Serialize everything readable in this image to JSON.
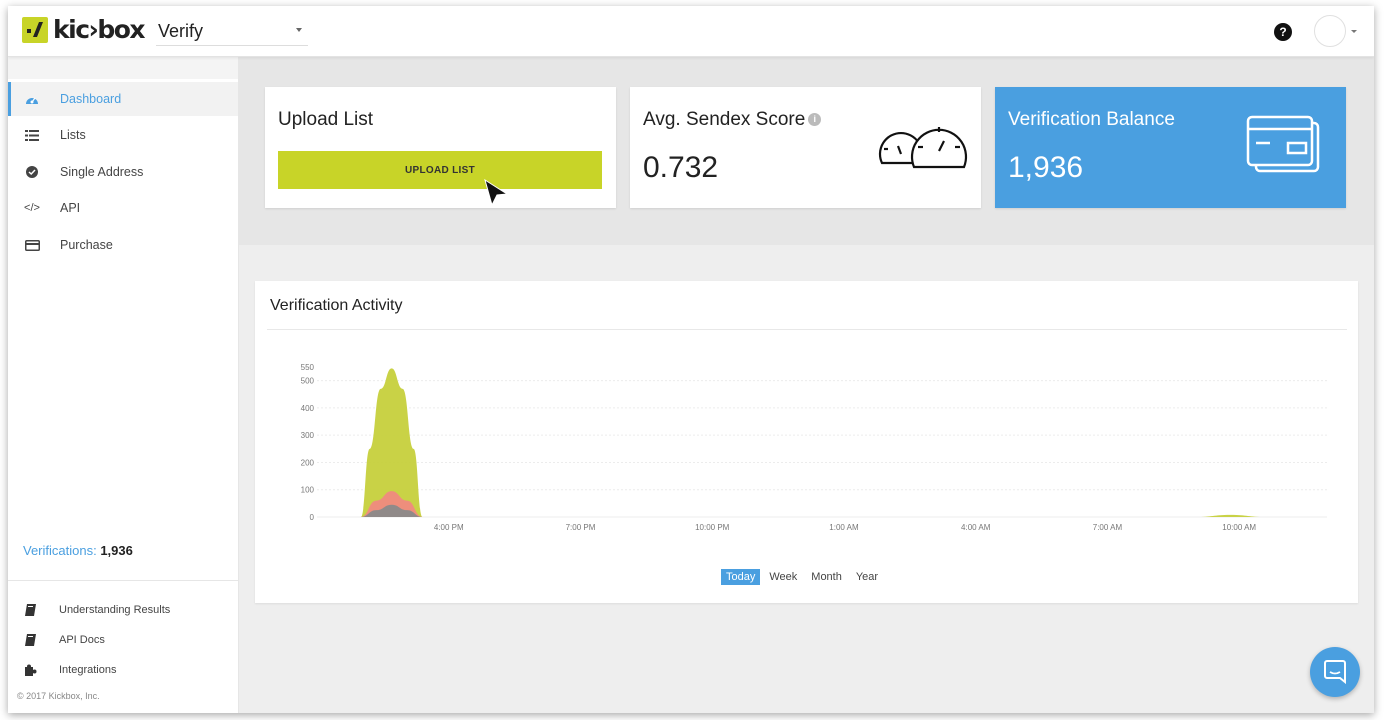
{
  "header": {
    "logo_text": "kic›box",
    "product_selector": "Verify",
    "help_icon": "question-circle-icon",
    "avatar_icon": "user-avatar"
  },
  "sidebar": {
    "items": [
      {
        "label": "Dashboard",
        "icon": "dashboard-icon",
        "active": true
      },
      {
        "label": "Lists",
        "icon": "list-icon",
        "active": false
      },
      {
        "label": "Single Address",
        "icon": "check-circle-icon",
        "active": false
      },
      {
        "label": "API",
        "icon": "code-icon",
        "active": false
      },
      {
        "label": "Purchase",
        "icon": "credit-card-icon",
        "active": false
      }
    ],
    "verifications_label": "Verifications:",
    "verifications_value": "1,936",
    "footer_links": [
      {
        "label": "Understanding Results",
        "icon": "book-icon"
      },
      {
        "label": "API Docs",
        "icon": "book-icon"
      },
      {
        "label": "Integrations",
        "icon": "puzzle-icon"
      }
    ],
    "copyright": "© 2017 Kickbox, Inc."
  },
  "cards": {
    "upload": {
      "title": "Upload List",
      "button": "UPLOAD LIST"
    },
    "sendex": {
      "title": "Avg. Sendex Score",
      "value": "0.732",
      "icon": "gauge-icon"
    },
    "balance": {
      "title": "Verification Balance",
      "value": "1,936",
      "icon": "credit-card-icon",
      "color": "#4a9fe0"
    }
  },
  "activity": {
    "title": "Verification Activity",
    "ranges": [
      "Today",
      "Week",
      "Month",
      "Year"
    ],
    "selected_range": "Today"
  },
  "chart_data": {
    "type": "area",
    "title": "",
    "y_ticks": [
      0,
      100,
      200,
      300,
      400,
      500,
      550
    ],
    "ylim": [
      0,
      550
    ],
    "x_ticks": [
      "4:00 PM",
      "7:00 PM",
      "10:00 PM",
      "1:00 AM",
      "4:00 AM",
      "7:00 AM",
      "10:00 AM"
    ],
    "x_hours": [
      3,
      6,
      9,
      12,
      15,
      18,
      21
    ],
    "series": [
      {
        "points": [
          [
            0.1,
            0
          ],
          [
            1.0,
            0
          ],
          [
            1.35,
            25
          ],
          [
            1.7,
            45
          ],
          [
            2.05,
            25
          ],
          [
            2.4,
            0
          ],
          [
            21.0,
            0
          ]
        ],
        "color": "#8a8a8a"
      },
      {
        "points": [
          [
            0.1,
            0
          ],
          [
            1.0,
            0
          ],
          [
            1.35,
            60
          ],
          [
            1.7,
            95
          ],
          [
            2.05,
            60
          ],
          [
            2.4,
            0
          ],
          [
            21.0,
            0
          ]
        ],
        "color": "#f08a80"
      },
      {
        "points": [
          [
            0.1,
            0
          ],
          [
            1.0,
            0
          ],
          [
            1.2,
            250
          ],
          [
            1.45,
            470
          ],
          [
            1.7,
            545
          ],
          [
            1.95,
            470
          ],
          [
            2.2,
            250
          ],
          [
            2.4,
            0
          ],
          [
            20.0,
            0
          ],
          [
            20.8,
            8
          ],
          [
            21.6,
            0
          ]
        ],
        "color": "#c6d03c"
      }
    ],
    "grid": true,
    "legend": "none"
  },
  "chat_button_icon": "chat-icon"
}
